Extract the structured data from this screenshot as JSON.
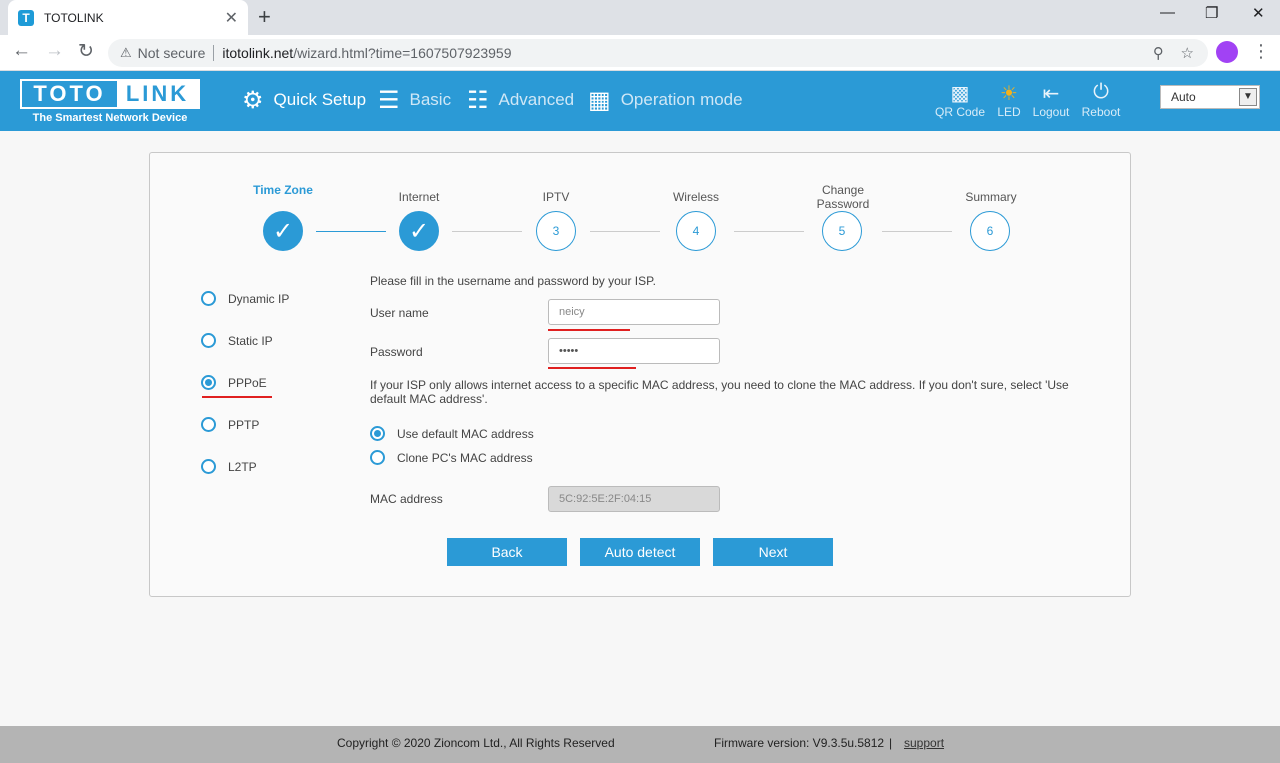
{
  "browser": {
    "tab_title": "TOTOLINK",
    "tab_favicon": "T",
    "tab_close": "✕",
    "new_tab": "+",
    "security_label": "Not secure",
    "url_host": "itotolink.net",
    "url_path": "/wizard.html?time=1607507923959"
  },
  "header": {
    "logo_left": "TOTO",
    "logo_right": "LINK",
    "tagline": "The Smartest Network Device",
    "nav": {
      "quick_setup": "Quick Setup",
      "basic": "Basic",
      "advanced": "Advanced",
      "operation_mode": "Operation mode"
    },
    "actions": {
      "qr_code": "QR Code",
      "led": "LED",
      "logout": "Logout",
      "reboot": "Reboot"
    },
    "language": "Auto"
  },
  "wizard": {
    "steps": [
      {
        "label": "Time Zone",
        "number": "1",
        "state": "done"
      },
      {
        "label": "Internet",
        "number": "2",
        "state": "done"
      },
      {
        "label": "IPTV",
        "number": "3",
        "state": "pending"
      },
      {
        "label": "Wireless",
        "number": "4",
        "state": "pending"
      },
      {
        "label": "Change Password",
        "number": "5",
        "state": "pending"
      },
      {
        "label": "Summary",
        "number": "6",
        "state": "pending"
      }
    ],
    "connection_types": [
      {
        "label": "Dynamic IP",
        "checked": false
      },
      {
        "label": "Static IP",
        "checked": false
      },
      {
        "label": "PPPoE",
        "checked": true
      },
      {
        "label": "PPTP",
        "checked": false
      },
      {
        "label": "L2TP",
        "checked": false
      }
    ],
    "instruction": "Please fill in the username and password by your ISP.",
    "username_label": "User name",
    "username_value": "neicy",
    "password_label": "Password",
    "password_value": "•••••",
    "mac_note": "If your ISP only allows internet access to a specific MAC address, you need to clone the MAC address. If you don't sure, select 'Use default MAC address'.",
    "mac_options": [
      {
        "label": "Use default MAC address",
        "checked": true
      },
      {
        "label": "Clone PC's MAC address",
        "checked": false
      }
    ],
    "mac_label": "MAC address",
    "mac_value": "5C:92:5E:2F:04:15",
    "buttons": {
      "back": "Back",
      "auto_detect": "Auto detect",
      "next": "Next"
    }
  },
  "footer": {
    "copyright": "Copyright © 2020 Zioncom Ltd., All Rights Reserved",
    "firmware": "Firmware version: V9.3.5u.5812",
    "divider": "|",
    "support": "support"
  },
  "colors": {
    "accent": "#2b9ad6",
    "annotation_underline": "#e02020"
  }
}
